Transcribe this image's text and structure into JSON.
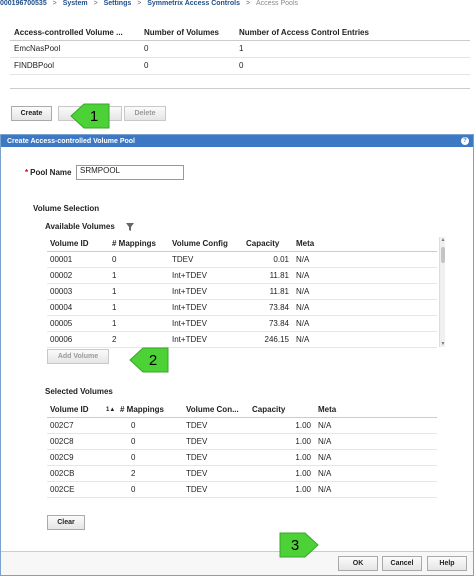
{
  "breadcrumb": {
    "array": "000196700535",
    "items": [
      "System",
      "Settings",
      "Symmetrix Access Controls",
      "Access Pools"
    ],
    "separator": ">"
  },
  "pools_table": {
    "headers": [
      "Access-controlled Volume ...",
      "Number of Volumes",
      "Number of Access Control Entries"
    ],
    "rows": [
      [
        "EmcNasPool",
        "0",
        "1"
      ],
      [
        "FINDBPool",
        "0",
        "0"
      ]
    ]
  },
  "toolbar": {
    "create_label": "Create",
    "view_label": "",
    "delete_label": "Delete"
  },
  "callouts": [
    "1",
    "2",
    "3"
  ],
  "callout_color": "#4cd137",
  "dialog": {
    "title": "Create Access-controlled Volume Pool",
    "help_icon": "?",
    "pool_name_label": "Pool Name",
    "pool_name_value": "SRMPOOL",
    "volume_selection_label": "Volume Selection",
    "available_label": "Available Volumes",
    "filter_icon": "filter-icon",
    "available_headers": [
      "Volume ID",
      "# Mappings",
      "Volume Config",
      "Capacity",
      "Meta"
    ],
    "available_rows": [
      [
        "00001",
        "0",
        "TDEV",
        "0.01",
        "N/A"
      ],
      [
        "00002",
        "1",
        "Int+TDEV",
        "11.81",
        "N/A"
      ],
      [
        "00003",
        "1",
        "Int+TDEV",
        "11.81",
        "N/A"
      ],
      [
        "00004",
        "1",
        "Int+TDEV",
        "73.84",
        "N/A"
      ],
      [
        "00005",
        "1",
        "Int+TDEV",
        "73.84",
        "N/A"
      ],
      [
        "00006",
        "2",
        "Int+TDEV",
        "246.15",
        "N/A"
      ]
    ],
    "add_volume_label": "Add Volume",
    "selected_label": "Selected Volumes",
    "selected_headers": [
      "Volume ID",
      "# Mappings",
      "Volume Con...",
      "Capacity",
      "Meta"
    ],
    "sort_indicator": "1▲",
    "selected_rows": [
      [
        "002C7",
        "0",
        "TDEV",
        "1.00",
        "N/A"
      ],
      [
        "002C8",
        "0",
        "TDEV",
        "1.00",
        "N/A"
      ],
      [
        "002C9",
        "0",
        "TDEV",
        "1.00",
        "N/A"
      ],
      [
        "002CB",
        "2",
        "TDEV",
        "1.00",
        "N/A"
      ],
      [
        "002CE",
        "0",
        "TDEV",
        "1.00",
        "N/A"
      ]
    ],
    "clear_label": "Clear",
    "ok_label": "OK",
    "cancel_label": "Cancel",
    "help_label": "Help"
  },
  "colors": {
    "titlebar": "#3d78c5",
    "breadcrumb": "#1f4e8a"
  }
}
